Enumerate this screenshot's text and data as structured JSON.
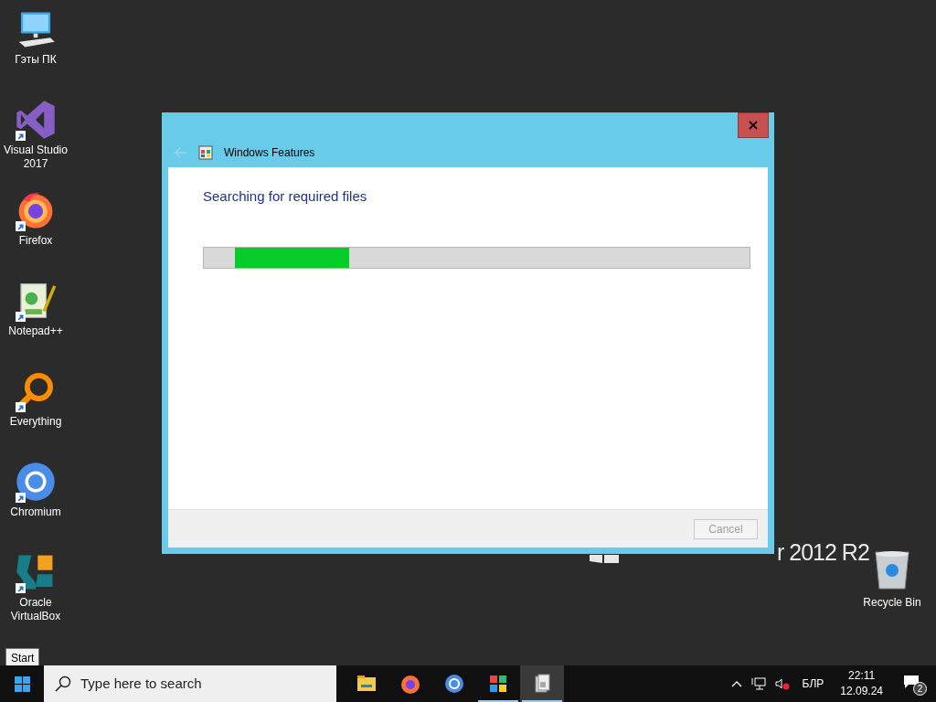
{
  "desktop_icons": [
    {
      "kind": "computer",
      "label": "Гэты ПК",
      "shortcut": false
    },
    {
      "kind": "vs",
      "label": "Visual Studio 2017",
      "shortcut": true
    },
    {
      "kind": "firefox",
      "label": "Firefox",
      "shortcut": true
    },
    {
      "kind": "notepad",
      "label": "Notepad++",
      "shortcut": true
    },
    {
      "kind": "everything",
      "label": "Everything",
      "shortcut": true
    },
    {
      "kind": "chromium",
      "label": "Chromium",
      "shortcut": true
    },
    {
      "kind": "virtualbox",
      "label": "Oracle VirtualBox",
      "shortcut": true
    }
  ],
  "recycle_bin": {
    "label": "Recycle Bin"
  },
  "wallpaper": {
    "text": "r 2012 R2"
  },
  "dialog": {
    "title": "Windows Features",
    "heading": "Searching for required files",
    "progress": {
      "level": 0.21
    },
    "cancel": {
      "label": "Cancel",
      "disabled": true
    }
  },
  "tooltip": {
    "text": "Start"
  },
  "taskbar": {
    "search": {
      "placeholder": "Type here to search"
    },
    "apps": [
      {
        "kind": "explorer",
        "running": false,
        "selected": false
      },
      {
        "kind": "firefox",
        "running": false,
        "selected": false
      },
      {
        "kind": "chromium",
        "running": false,
        "selected": false
      },
      {
        "kind": "features",
        "running": true,
        "selected": false
      },
      {
        "kind": "server",
        "running": true,
        "selected": true
      }
    ],
    "tray": {
      "language": "БЛР",
      "time": "22:11",
      "date": "12.09.24",
      "notifications": "2"
    }
  }
}
